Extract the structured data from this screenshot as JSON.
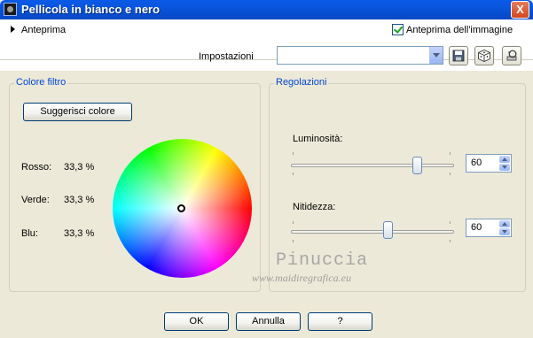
{
  "window": {
    "title": "Pellicola in bianco e nero",
    "close_label": "X"
  },
  "top_bar": {
    "preview_label": "Anteprima",
    "image_preview_label": "Anteprima dell'immagine",
    "image_preview_checked": true,
    "settings_label": "Impostazioni",
    "settings_value": ""
  },
  "filter_group": {
    "title": "Colore filtro",
    "suggest_button": "Suggerisci colore",
    "channels": [
      {
        "label": "Rosso:",
        "value": "33,3 %"
      },
      {
        "label": "Verde:",
        "value": "33,3 %"
      },
      {
        "label": "Blu:",
        "value": "33,3 %"
      }
    ]
  },
  "adjust_group": {
    "title": "Regolazioni",
    "brightness": {
      "label": "Luminosità:",
      "value": "60",
      "slider_fraction": 0.78
    },
    "sharpness": {
      "label": "Nitidezza:",
      "value": "60",
      "slider_fraction": 0.58
    }
  },
  "watermark": {
    "name": "Pinuccia",
    "url": "www.maidiregrafica.eu"
  },
  "buttons": {
    "ok": "OK",
    "cancel": "Annulla",
    "help": "?"
  },
  "icons": {
    "title_icon": "camera-film-icon",
    "save_icon": "floppy-disk-icon",
    "random_icon": "dice-icon",
    "reset_icon": "reset-defaults-icon"
  }
}
